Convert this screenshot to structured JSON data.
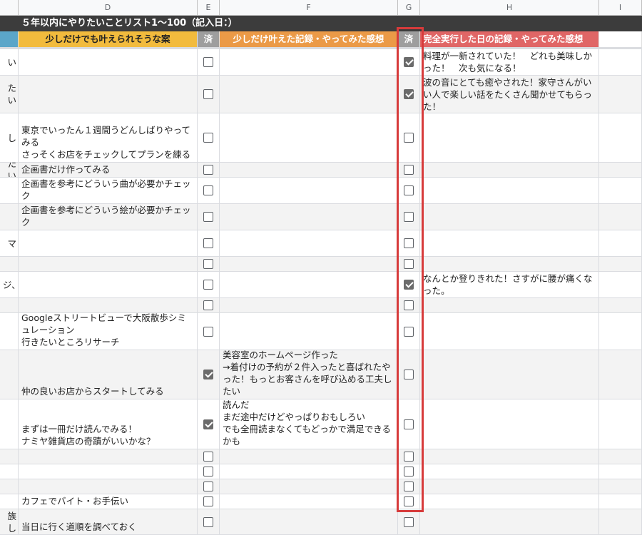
{
  "column_headers": [
    "D",
    "E",
    "F",
    "G",
    "H",
    "I"
  ],
  "sheet_title": "５年以内にやりたいことリスト1〜100（記入日：）",
  "headers": {
    "d": "少しだけでも叶えられそうな案",
    "e": "済",
    "f": "少しだけ叶えた記録・やってみた感想",
    "g": "済",
    "h": "完全実行した日の記録・やってみた感想"
  },
  "colors": {
    "title_bg": "#3c3c3c",
    "header_c": "#5ba6c9",
    "header_d": "#f2bb3d",
    "header_e": "#9e9e9e",
    "header_f": "#eb9a47",
    "header_g": "#9e9e9e",
    "header_h": "#e06666",
    "highlight": "#d73b3b"
  },
  "rows": [
    {
      "c": "い",
      "d": "",
      "e": false,
      "f": "",
      "g": true,
      "h": "料理が一新されていた！　どれも美味しかった！　次も気になる！",
      "shade": false
    },
    {
      "c": "たい",
      "d": "",
      "e": false,
      "f": "",
      "g": true,
      "h": "波の音にとても癒やされた！家守さんがいい人で楽しい話をたくさん聞かせてもらった！",
      "shade": true
    },
    {
      "c": "し",
      "d": "東京でいったん１週間うどんしばりやってみる\nさっそくお店をチェックしてプランを練る",
      "e": false,
      "f": "",
      "g": false,
      "h": "",
      "shade": false
    },
    {
      "c": "たい",
      "d": "企画書だけ作ってみる",
      "e": false,
      "f": "",
      "g": false,
      "h": "",
      "shade": true
    },
    {
      "c": "",
      "d": "企画書を参考にどういう曲が必要かチェック",
      "e": false,
      "f": "",
      "g": false,
      "h": "",
      "shade": false
    },
    {
      "c": "",
      "d": "企画書を参考にどういう絵が必要かチェック",
      "e": false,
      "f": "",
      "g": false,
      "h": "",
      "shade": true
    },
    {
      "c": "マ",
      "d": "",
      "e": false,
      "f": "",
      "g": false,
      "h": "",
      "shade": false
    },
    {
      "c": "",
      "d": "",
      "e": false,
      "f": "",
      "g": false,
      "h": "",
      "shade": true
    },
    {
      "c": "ジ、",
      "d": "",
      "e": false,
      "f": "",
      "g": true,
      "h": "なんとか登りきれた！さすがに腰が痛くなった。",
      "shade": false
    },
    {
      "c": "",
      "d": "",
      "e": false,
      "f": "",
      "g": false,
      "h": "",
      "shade": true
    },
    {
      "c": "",
      "d": "Googleストリートビューで大阪散歩シミュレーション\n行きたいところリサーチ",
      "e": false,
      "f": "",
      "g": false,
      "h": "",
      "shade": false
    },
    {
      "c": "",
      "d": "仲の良いお店からスタートしてみる",
      "e": true,
      "f": "美容室のホームページ作った\n→着付けの予約が２件入ったと喜ばれたやった！もっとお客さんを呼び込める工夫したい",
      "g": false,
      "h": "",
      "shade": true
    },
    {
      "c": "",
      "d": "まずは一冊だけ読んでみる！\nナミヤ雑貨店の奇蹟がいいかな？",
      "e": true,
      "f": "読んだ\nまだ途中だけどやっぱりおもしろい\nでも全冊読まなくてもどっかで満足できるかも",
      "g": false,
      "h": "",
      "shade": false
    },
    {
      "c": "",
      "d": "",
      "e": false,
      "f": "",
      "g": false,
      "h": "",
      "shade": true
    },
    {
      "c": "",
      "d": "",
      "e": false,
      "f": "",
      "g": false,
      "h": "",
      "shade": false
    },
    {
      "c": "",
      "d": "",
      "e": false,
      "f": "",
      "g": false,
      "h": "",
      "shade": true
    },
    {
      "c": "",
      "d": "カフェでバイト・お手伝い",
      "e": false,
      "f": "",
      "g": false,
      "h": "",
      "shade": false
    },
    {
      "c": "族し",
      "d": "当日に行く道順を調べておく",
      "e": false,
      "f": "",
      "g": false,
      "h": "",
      "shade": true
    }
  ]
}
